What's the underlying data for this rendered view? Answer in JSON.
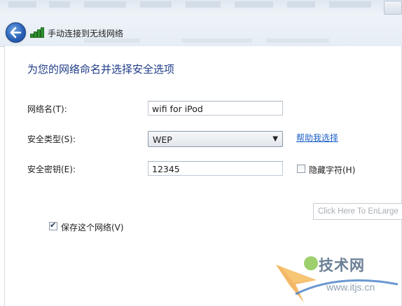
{
  "window": {
    "title": "手动连接到无线网络"
  },
  "dialog": {
    "heading": "为您的网络命名并选择安全选项",
    "network_name": {
      "label": "网络名(T):",
      "value": "wifi for iPod"
    },
    "security_type": {
      "label": "安全类型(S):",
      "selected": "WEP",
      "help_link": "帮助我选择"
    },
    "security_key": {
      "label": "安全密钥(E):",
      "value": "12345",
      "hide_chars_label": "隐藏字符(H)",
      "hide_chars_checked": false
    },
    "save_network": {
      "label": "保存这个网络(V)",
      "checked": true
    }
  },
  "overlay": {
    "enlarge_text": "Click Here To EnLarge"
  },
  "watermark": {
    "text": "技术网",
    "url": "www.itjs.cn"
  },
  "colors": {
    "heading": "#1f3c88",
    "link": "#1b5fc8",
    "accent_green": "#2f8f2f"
  }
}
